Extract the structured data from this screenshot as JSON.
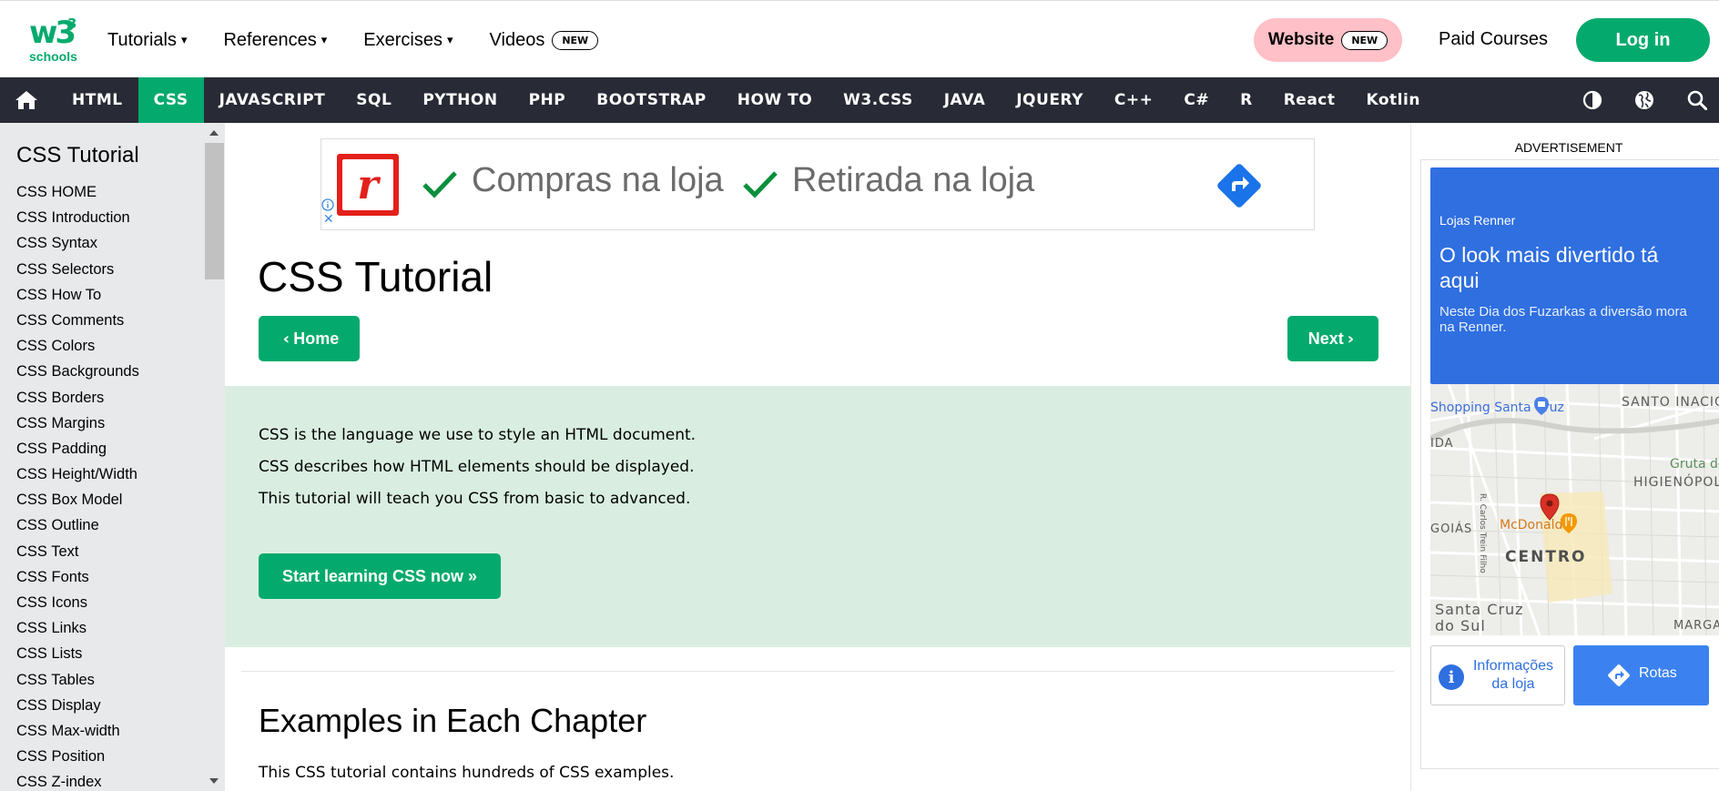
{
  "logo": {
    "mark": "w3",
    "superscript": "3",
    "sub": "schools"
  },
  "topnav": {
    "items": [
      {
        "label": "Tutorials",
        "caret": "▾"
      },
      {
        "label": "References",
        "caret": "▾"
      },
      {
        "label": "Exercises",
        "caret": "▾"
      },
      {
        "label": "Videos",
        "badge": "NEW"
      }
    ],
    "website_label": "Website",
    "website_badge": "NEW",
    "paid_courses": "Paid Courses",
    "login": "Log in"
  },
  "subnav": {
    "home_icon": "home-icon",
    "items": [
      "HTML",
      "CSS",
      "JAVASCRIPT",
      "SQL",
      "PYTHON",
      "PHP",
      "BOOTSTRAP",
      "HOW TO",
      "W3.CSS",
      "JAVA",
      "JQUERY",
      "C++",
      "C#",
      "R",
      "React",
      "Kotlin"
    ],
    "active": "CSS",
    "right_icons": [
      "contrast-icon",
      "globe-icon",
      "search-icon"
    ]
  },
  "sidebar": {
    "title": "CSS Tutorial",
    "items": [
      "CSS HOME",
      "CSS Introduction",
      "CSS Syntax",
      "CSS Selectors",
      "CSS How To",
      "CSS Comments",
      "CSS Colors",
      "CSS Backgrounds",
      "CSS Borders",
      "CSS Margins",
      "CSS Padding",
      "CSS Height/Width",
      "CSS Box Model",
      "CSS Outline",
      "CSS Text",
      "CSS Fonts",
      "CSS Icons",
      "CSS Links",
      "CSS Lists",
      "CSS Tables",
      "CSS Display",
      "CSS Max-width",
      "CSS Position",
      "CSS Z-index"
    ]
  },
  "ad_banner": {
    "logo_letter": "r",
    "text1": "Compras na loja",
    "text2": "Retirada na loja",
    "close": "✕"
  },
  "main": {
    "title": "CSS Tutorial",
    "home_button": "Home",
    "next_button": "Next",
    "intro": [
      "CSS is the language we use to style an HTML document.",
      "CSS describes how HTML elements should be displayed.",
      "This tutorial will teach you CSS from basic to advanced."
    ],
    "start_button": "Start learning CSS now »",
    "examples_title": "Examples in Each Chapter",
    "examples_text": "This CSS tutorial contains hundreds of CSS examples."
  },
  "right_ad": {
    "label": "ADVERTISEMENT",
    "brand": "Lojas Renner",
    "headline": "O look mais divertido tá aqui",
    "sub": "Neste Dia dos Fuzarkas a diversão mora na Renner.",
    "map_labels": {
      "shopping": "Shopping Santa Cruz",
      "santo_inacio": "SANTO INACIO",
      "ida": "IDA",
      "gruta": "Gruta do",
      "higienopolis": "HIGIENÓPOL",
      "street": "R. Carlos Trein Filho",
      "goias": "GOIÁS",
      "mcdonalds": "McDonald's",
      "centro": "CENTRO",
      "santa_cruz": "Santa Cruz",
      "do_sul": "do Sul",
      "marga": "MARGA"
    },
    "info_button": "Informações da loja",
    "route_button": "Rotas"
  },
  "colors": {
    "brand_green": "#04AA6D",
    "dark_nav": "#282A35",
    "sidebar_bg": "#E7E9EB",
    "intro_bg": "#D9EEE1",
    "website_pill": "#FFC0C7",
    "ad_blue": "#2F6FE0"
  }
}
